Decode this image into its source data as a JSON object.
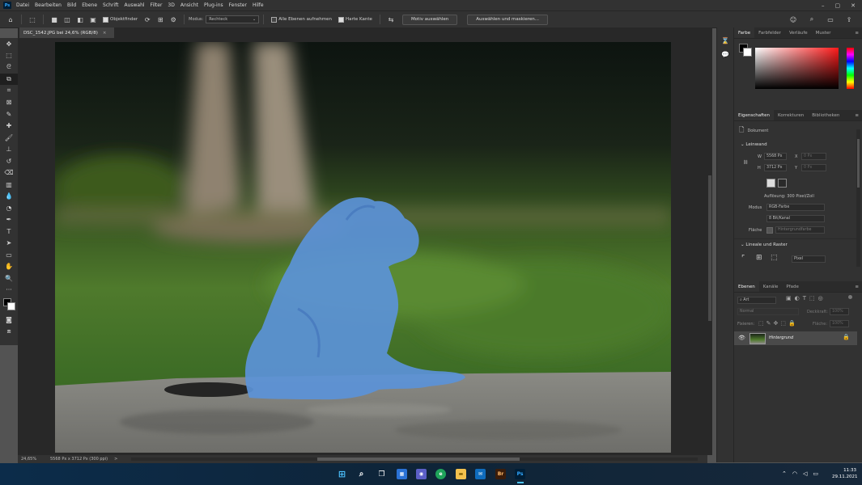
{
  "app": {
    "logo": "Ps"
  },
  "menu": [
    "Datei",
    "Bearbeiten",
    "Bild",
    "Ebene",
    "Schrift",
    "Auswahl",
    "Filter",
    "3D",
    "Ansicht",
    "Plug-ins",
    "Fenster",
    "Hilfe"
  ],
  "options": {
    "objektfinder": "Objektfinder",
    "modus_label": "Modus:",
    "modus_value": "Rechteck",
    "alle_ebenen": "Alle Ebenen aufnehmen",
    "harte_kante": "Harte Kante",
    "motiv_button": "Motiv auswählen",
    "auswaehlen_button": "Auswählen und maskieren..."
  },
  "document": {
    "tab_title": "DSC_1542.JPG bei 24,6% (RGB/8)",
    "close": "×"
  },
  "status": {
    "zoom": "24,65%",
    "info": "5568 Px x 3712 Px (300 ppi)",
    "arrow": ">"
  },
  "color_panel": {
    "tabs": [
      "Farbe",
      "Farbfelder",
      "Verläufe",
      "Muster"
    ],
    "active": 0
  },
  "properties": {
    "tabs": [
      "Eigenschaften",
      "Korrekturen",
      "Bibliotheken"
    ],
    "doc_label": "Dokument",
    "leinwand": "Leinwand",
    "w_label": "W",
    "w_value": "5568 Px",
    "h_label": "H",
    "h_value": "3712 Px",
    "x_label": "X",
    "x_value": "0 Px",
    "y_label": "Y",
    "y_value": "0 Px",
    "aufloesung": "Auflösung: 300 Pixel/Zoll",
    "modus_label": "Modus",
    "modus_value": "RGB-Farbe",
    "bit_value": "8 Bit/Kanal",
    "flaeche_label": "Fläche",
    "flaeche_value": "Hintergrundfarbe",
    "lineale": "Lineale und Raster",
    "unit_value": "Pixel"
  },
  "layers": {
    "tabs": [
      "Ebenen",
      "Kanäle",
      "Pfade"
    ],
    "filter_label": "Art",
    "blend": "Normal",
    "opacity_label": "Deckkraft:",
    "opacity_value": "100%",
    "fix_label": "Fixieren:",
    "fill_label": "Fläche:",
    "fill_value": "100%",
    "layer_name": "Hintergrund"
  },
  "taskbar": {
    "time": "11:33",
    "date": "29.11.2021"
  },
  "colors": {
    "accent": "#31a8ff",
    "selection": "#5b93d8"
  }
}
